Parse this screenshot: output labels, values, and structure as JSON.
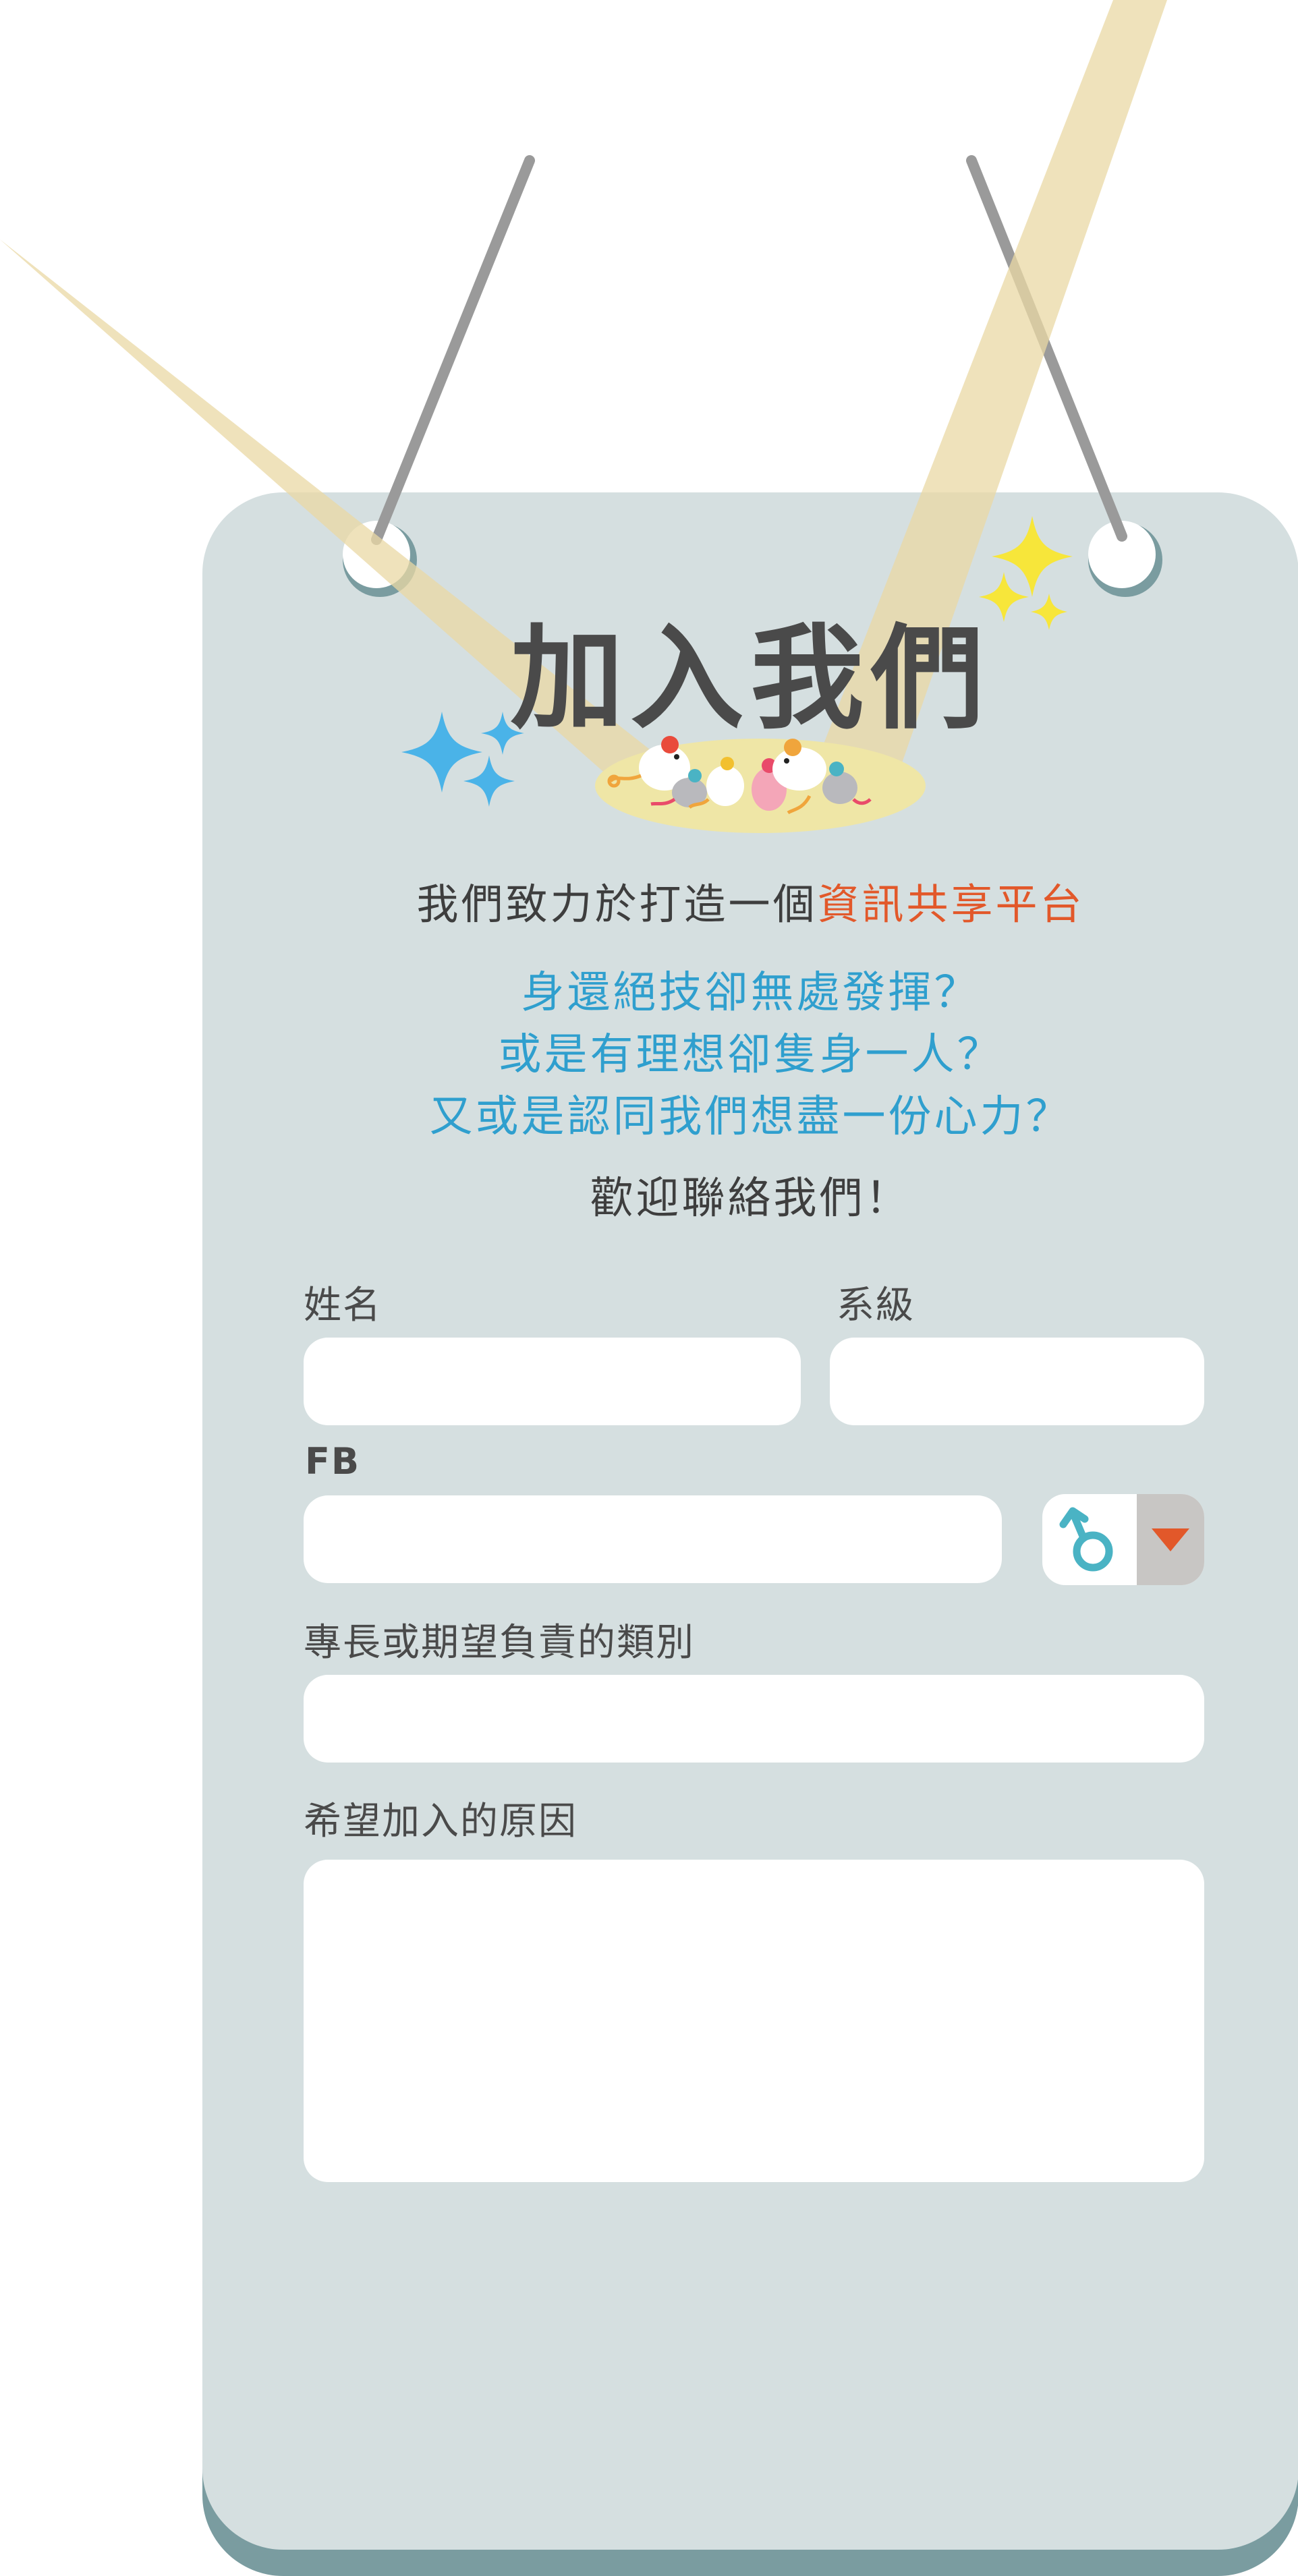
{
  "title": "加入我們",
  "intro": {
    "prefix": "我們致力於打造一個",
    "highlight": "資訊共享平台"
  },
  "questions": [
    "身還絕技卻無處發揮？",
    "或是有理想卻隻身一人？",
    "又或是認同我們想盡一份心力？"
  ],
  "welcome": "歡迎聯絡我們！",
  "form": {
    "name_label": "姓名",
    "name_value": "",
    "dept_label": "系級",
    "dept_value": "",
    "fb_label": "FB",
    "fb_value": "",
    "gender_icon": "male-symbol-icon",
    "specialty_label": "專長或期望負責的類別",
    "specialty_value": "",
    "reason_label": "希望加入的原因",
    "reason_value": ""
  },
  "colors": {
    "board": "#d5dfe0",
    "board_shadow": "#7a9ca0",
    "spotlight": "#e9d8a4",
    "highlight_text": "#e2582a",
    "question_text": "#2f9fce",
    "sparkle_blue": "#4ab3e8",
    "sparkle_yellow": "#f7e63a",
    "gender_icon": "#4ab3c4",
    "dropdown_arrow": "#e2582a"
  }
}
